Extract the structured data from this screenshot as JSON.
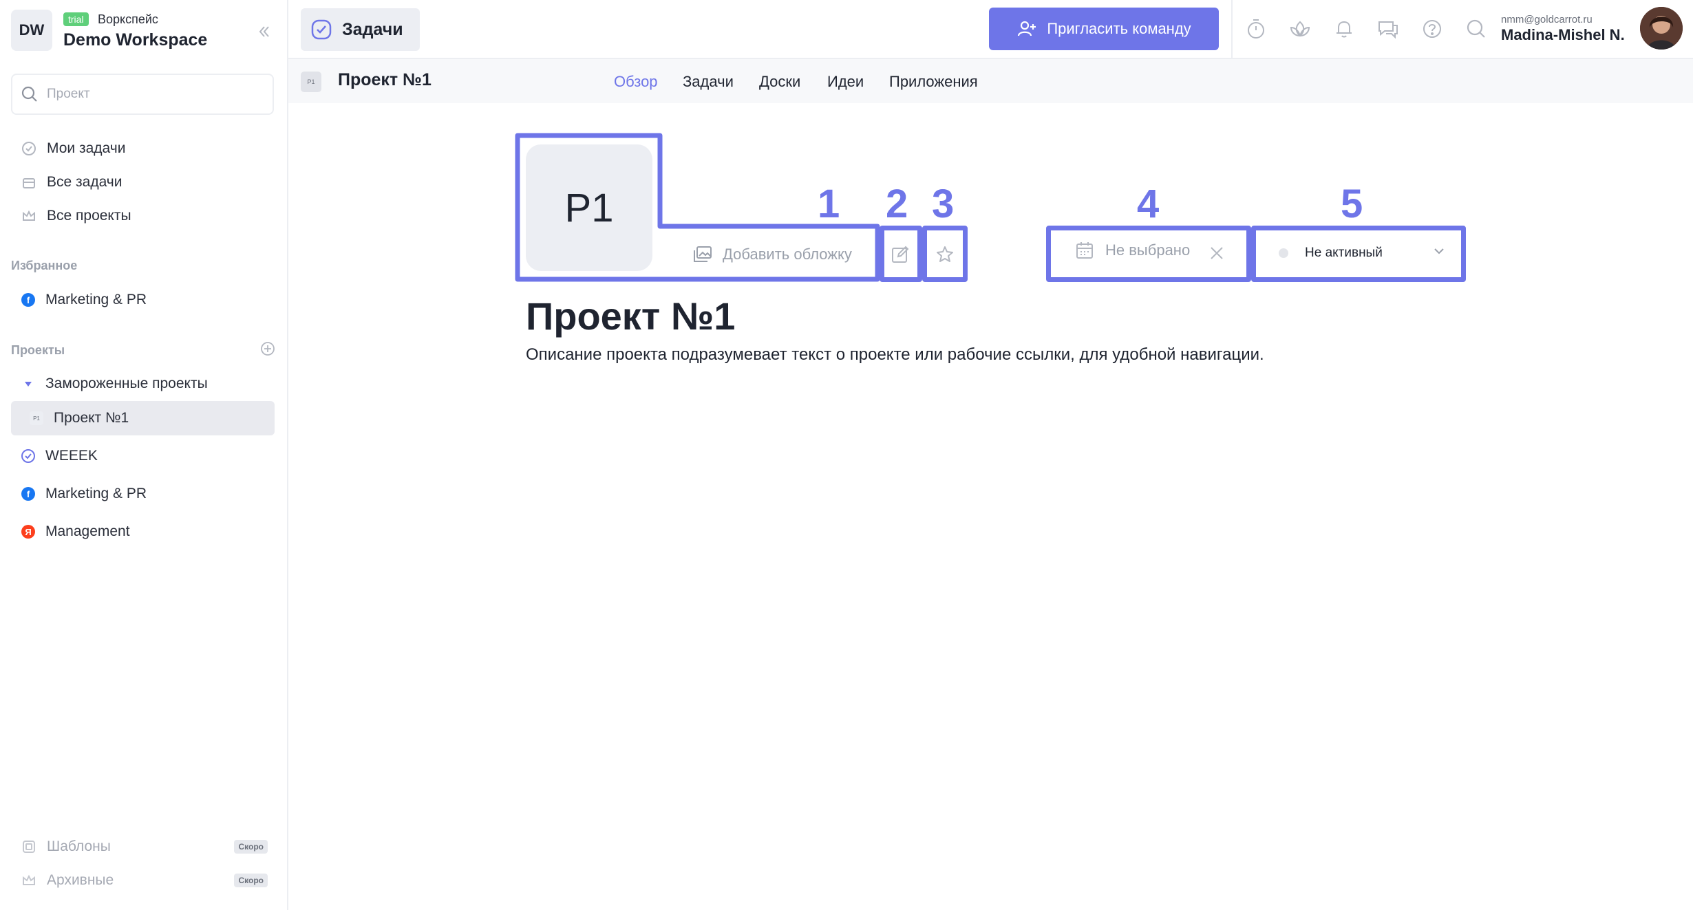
{
  "workspace": {
    "initials": "DW",
    "badge": "trial",
    "subtitle": "Воркспейс",
    "name": "Demo Workspace"
  },
  "sidebar": {
    "search_placeholder": "Проект",
    "nav": [
      {
        "label": "Мои задачи",
        "icon": "check-circle-icon"
      },
      {
        "label": "Все задачи",
        "icon": "inbox-icon"
      },
      {
        "label": "Все проекты",
        "icon": "crown-icon"
      }
    ],
    "favorites_label": "Избранное",
    "favorites": [
      {
        "label": "Marketing & PR",
        "icon": "facebook-icon",
        "color": "#1877f2"
      }
    ],
    "projects_label": "Проекты",
    "folder": {
      "label": "Замороженные проекты"
    },
    "folder_items": [
      {
        "label": "Проект №1",
        "badge": "P1",
        "active": true
      }
    ],
    "projects": [
      {
        "label": "WEEEK",
        "icon": "check-badge-icon",
        "color": "#6e75e8"
      },
      {
        "label": "Marketing & PR",
        "icon": "facebook-icon",
        "color": "#1877f2"
      },
      {
        "label": "Management",
        "icon": "yandex-icon",
        "color": "#fc3f1d"
      }
    ],
    "footer": [
      {
        "label": "Шаблоны",
        "badge": "Скоро",
        "icon": "template-icon"
      },
      {
        "label": "Архивные",
        "badge": "Скоро",
        "icon": "archive-icon"
      }
    ]
  },
  "topbar": {
    "module": "Задачи",
    "invite": "Пригласить команду",
    "icons": [
      "timer-icon",
      "lotus-icon",
      "bell-icon",
      "chat-icon",
      "help-icon",
      "search-icon"
    ],
    "user": {
      "email": "nmm@goldcarrot.ru",
      "name": "Madina-Mishel N."
    }
  },
  "project": {
    "badge": "P1",
    "title": "Проект №1",
    "tabs": [
      "Обзор",
      "Задачи",
      "Доски",
      "Идеи",
      "Приложения"
    ],
    "active_tab": "Обзор",
    "cover_initials": "P1",
    "add_cover": "Добавить обложку",
    "date_placeholder": "Не выбрано",
    "status": "Не активный",
    "heading": "Проект №1",
    "description": "Описание проекта подразумевает текст о проекте или рабочие ссылки, для удобной навигации."
  },
  "annotations": {
    "labels": [
      "1",
      "2",
      "3",
      "4",
      "5"
    ],
    "color": "#6e75e8"
  },
  "colors": {
    "accent": "#6e75e8",
    "trial": "#5fcf7a"
  }
}
